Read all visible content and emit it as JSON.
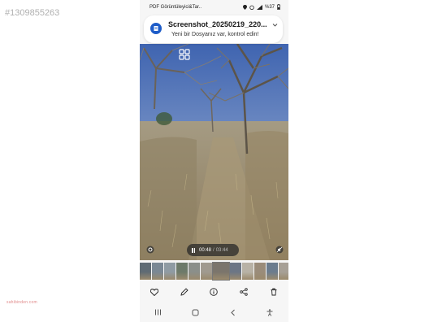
{
  "listing_id": "#1309855263",
  "watermark": "sahibinden.com",
  "status_bar": {
    "app_name": "PDF Görüntüleyici&Tar..",
    "battery_text": "%37"
  },
  "notification": {
    "title": "Screenshot_20250219_220...",
    "body": "Yeni bir Dosyanız var, kontrol edin!"
  },
  "video": {
    "current_time": "00:48",
    "separator": "/",
    "total_time": "03:44"
  },
  "filmstrip": {
    "thumb_colors": [
      "#5f6b74",
      "#7a8894",
      "#8f9ba3",
      "#6d7a6a",
      "#8b8f8a",
      "#a09a8f",
      "#7b756c",
      "#6c7685",
      "#b8b2a6",
      "#9a8c7a",
      "#6b7c8e",
      "#a7a096",
      "#c9c2b6",
      "#8a9bb0"
    ]
  },
  "actions": [
    "heart-icon",
    "pencil-icon",
    "info-icon",
    "share-icon",
    "trash-icon"
  ],
  "colors": {
    "accent": "#1e5cc8",
    "sky": "#4f6fb4",
    "ground": "#9b8a6c"
  }
}
